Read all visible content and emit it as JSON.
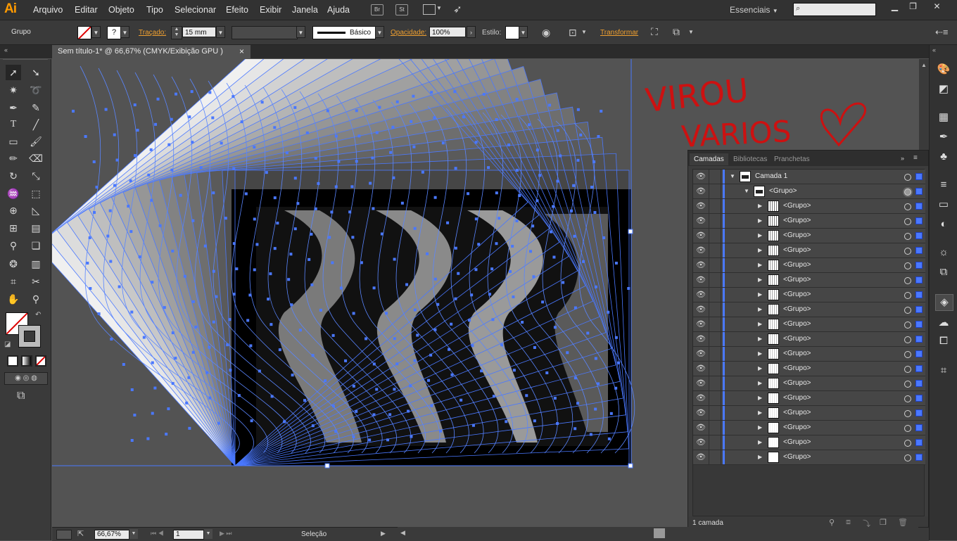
{
  "app": {
    "logo": "Ai",
    "workspace": "Essenciais"
  },
  "menu": [
    "Arquivo",
    "Editar",
    "Objeto",
    "Tipo",
    "Selecionar",
    "Efeito",
    "Exibir",
    "Janela",
    "Ajuda"
  ],
  "menu_icons": {
    "bridge": "Br",
    "stock": "St"
  },
  "control": {
    "selection_type": "Grupo",
    "stroke_label": "Traçado:",
    "stroke_weight": "15 mm",
    "brush_label": "Básico",
    "opacity_label": "Opacidade:",
    "opacity_value": "100%",
    "style_label": "Estilo:",
    "transform_label": "Transformar"
  },
  "document_tab": {
    "title": "Sem título-1* @ 66,67% (CMYK/Exibição GPU )",
    "close": "×"
  },
  "annotation": {
    "line1": "VIROU",
    "line2": "VARIOS",
    "color": "#cc1111"
  },
  "layers_panel": {
    "tabs": [
      "Camadas",
      "Bibliotecas",
      "Pranchetas"
    ],
    "layer": {
      "name": "Camada 1"
    },
    "group": {
      "name": "<Grupo>"
    },
    "children": [
      "<Grupo>",
      "<Grupo>",
      "<Grupo>",
      "<Grupo>",
      "<Grupo>",
      "<Grupo>",
      "<Grupo>",
      "<Grupo>",
      "<Grupo>",
      "<Grupo>",
      "<Grupo>",
      "<Grupo>",
      "<Grupo>",
      "<Grupo>",
      "<Grupo>",
      "<Grupo>",
      "<Grupo>",
      "<Grupo>"
    ],
    "footer": "1 camada",
    "accent": "#4a78ff"
  },
  "status": {
    "zoom": "66,67%",
    "page": "1",
    "tool": "Seleção"
  }
}
